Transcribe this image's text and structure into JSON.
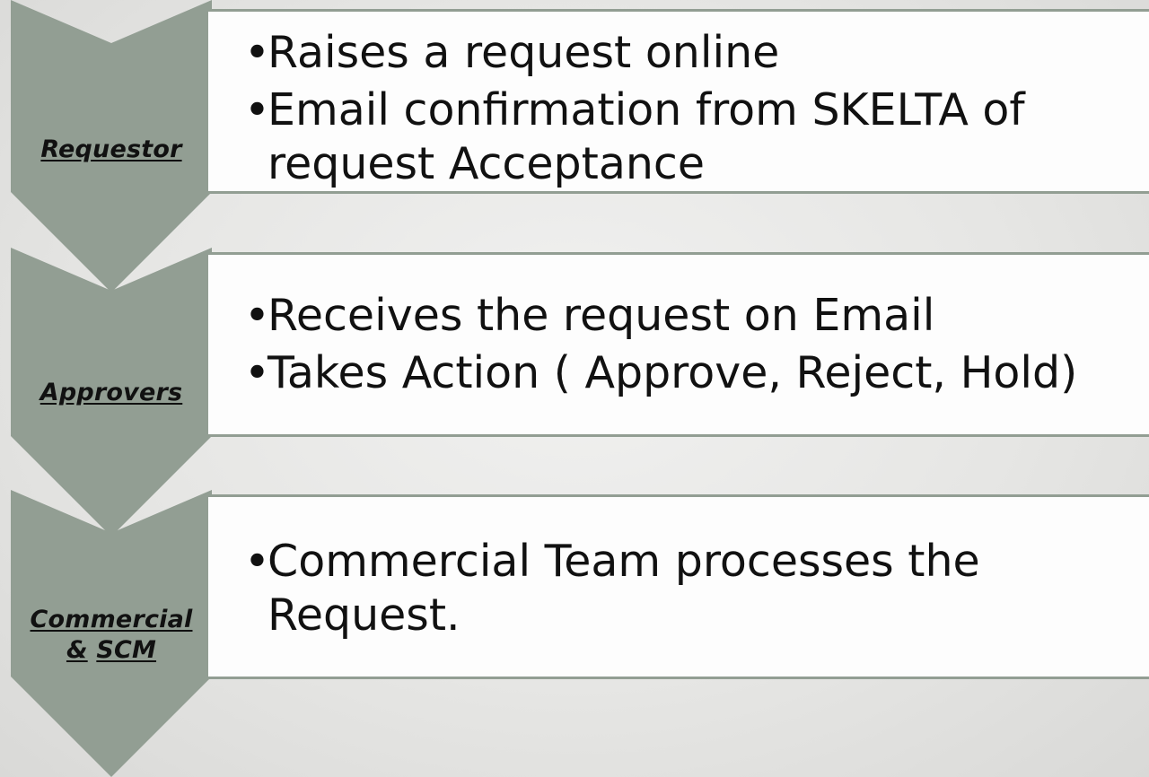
{
  "colors": {
    "chevron": "#929e93",
    "box_fill": "#fdfdfd",
    "box_border": "#929e93",
    "text": "#111111"
  },
  "steps": [
    {
      "label_parts": [
        "Requestor"
      ],
      "bullets": [
        "Raises a request online",
        "Email confirmation from SKELTA of request Acceptance"
      ]
    },
    {
      "label_parts": [
        "Approvers"
      ],
      "bullets": [
        "Receives the request on Email",
        "Takes Action ( Approve, Reject, Hold)"
      ]
    },
    {
      "label_parts": [
        "Commercial",
        "&",
        "SCM"
      ],
      "bullets": [
        "Commercial Team processes the Request."
      ]
    }
  ],
  "bullet_glyph": "•"
}
